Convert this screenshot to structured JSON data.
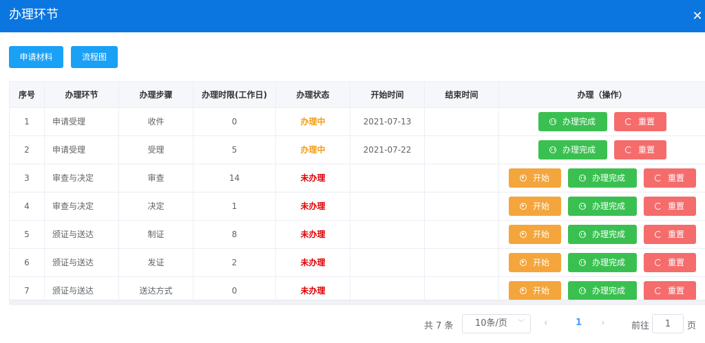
{
  "dialog": {
    "title": "办理环节",
    "close_icon": "close-icon"
  },
  "toolbar": {
    "apply_label": "申请材料",
    "flow_label": "流程图"
  },
  "table": {
    "headers": [
      "序号",
      "办理环节",
      "办理步骤",
      "办理时限(工作日)",
      "办理状态",
      "开始时间",
      "结束时间",
      "办理（操作）"
    ],
    "rows": [
      {
        "no": "1",
        "stage": "申请受理",
        "step": "收件",
        "limit": "0",
        "status": "办理中",
        "start": "2021-07-13",
        "end": ""
      },
      {
        "no": "2",
        "stage": "申请受理",
        "step": "受理",
        "limit": "5",
        "status": "办理中",
        "start": "2021-07-22",
        "end": ""
      },
      {
        "no": "3",
        "stage": "审查与决定",
        "step": "审查",
        "limit": "14",
        "status": "未办理",
        "start": "",
        "end": ""
      },
      {
        "no": "4",
        "stage": "审查与决定",
        "step": "决定",
        "limit": "1",
        "status": "未办理",
        "start": "",
        "end": ""
      },
      {
        "no": "5",
        "stage": "颁证与送达",
        "step": "制证",
        "limit": "8",
        "status": "未办理",
        "start": "",
        "end": ""
      },
      {
        "no": "6",
        "stage": "颁证与送达",
        "step": "发证",
        "limit": "2",
        "status": "未办理",
        "start": "",
        "end": ""
      },
      {
        "no": "7",
        "stage": "颁证与送达",
        "step": "送达方式",
        "limit": "0",
        "status": "未办理",
        "start": "",
        "end": ""
      }
    ],
    "actions": {
      "start": "开始",
      "done": "办理完成",
      "reset": "重置"
    },
    "colors": {
      "doing": "#f39c12",
      "none": "#e00000",
      "start_btn": "#f4a53b",
      "done_btn": "#3ac051",
      "reset_btn": "#f56c6c"
    }
  },
  "pagination": {
    "total": "共 7 条",
    "page_size": "10条/页",
    "current": "1",
    "goto_label": "前往",
    "goto_value": "1",
    "page_unit": "页"
  }
}
